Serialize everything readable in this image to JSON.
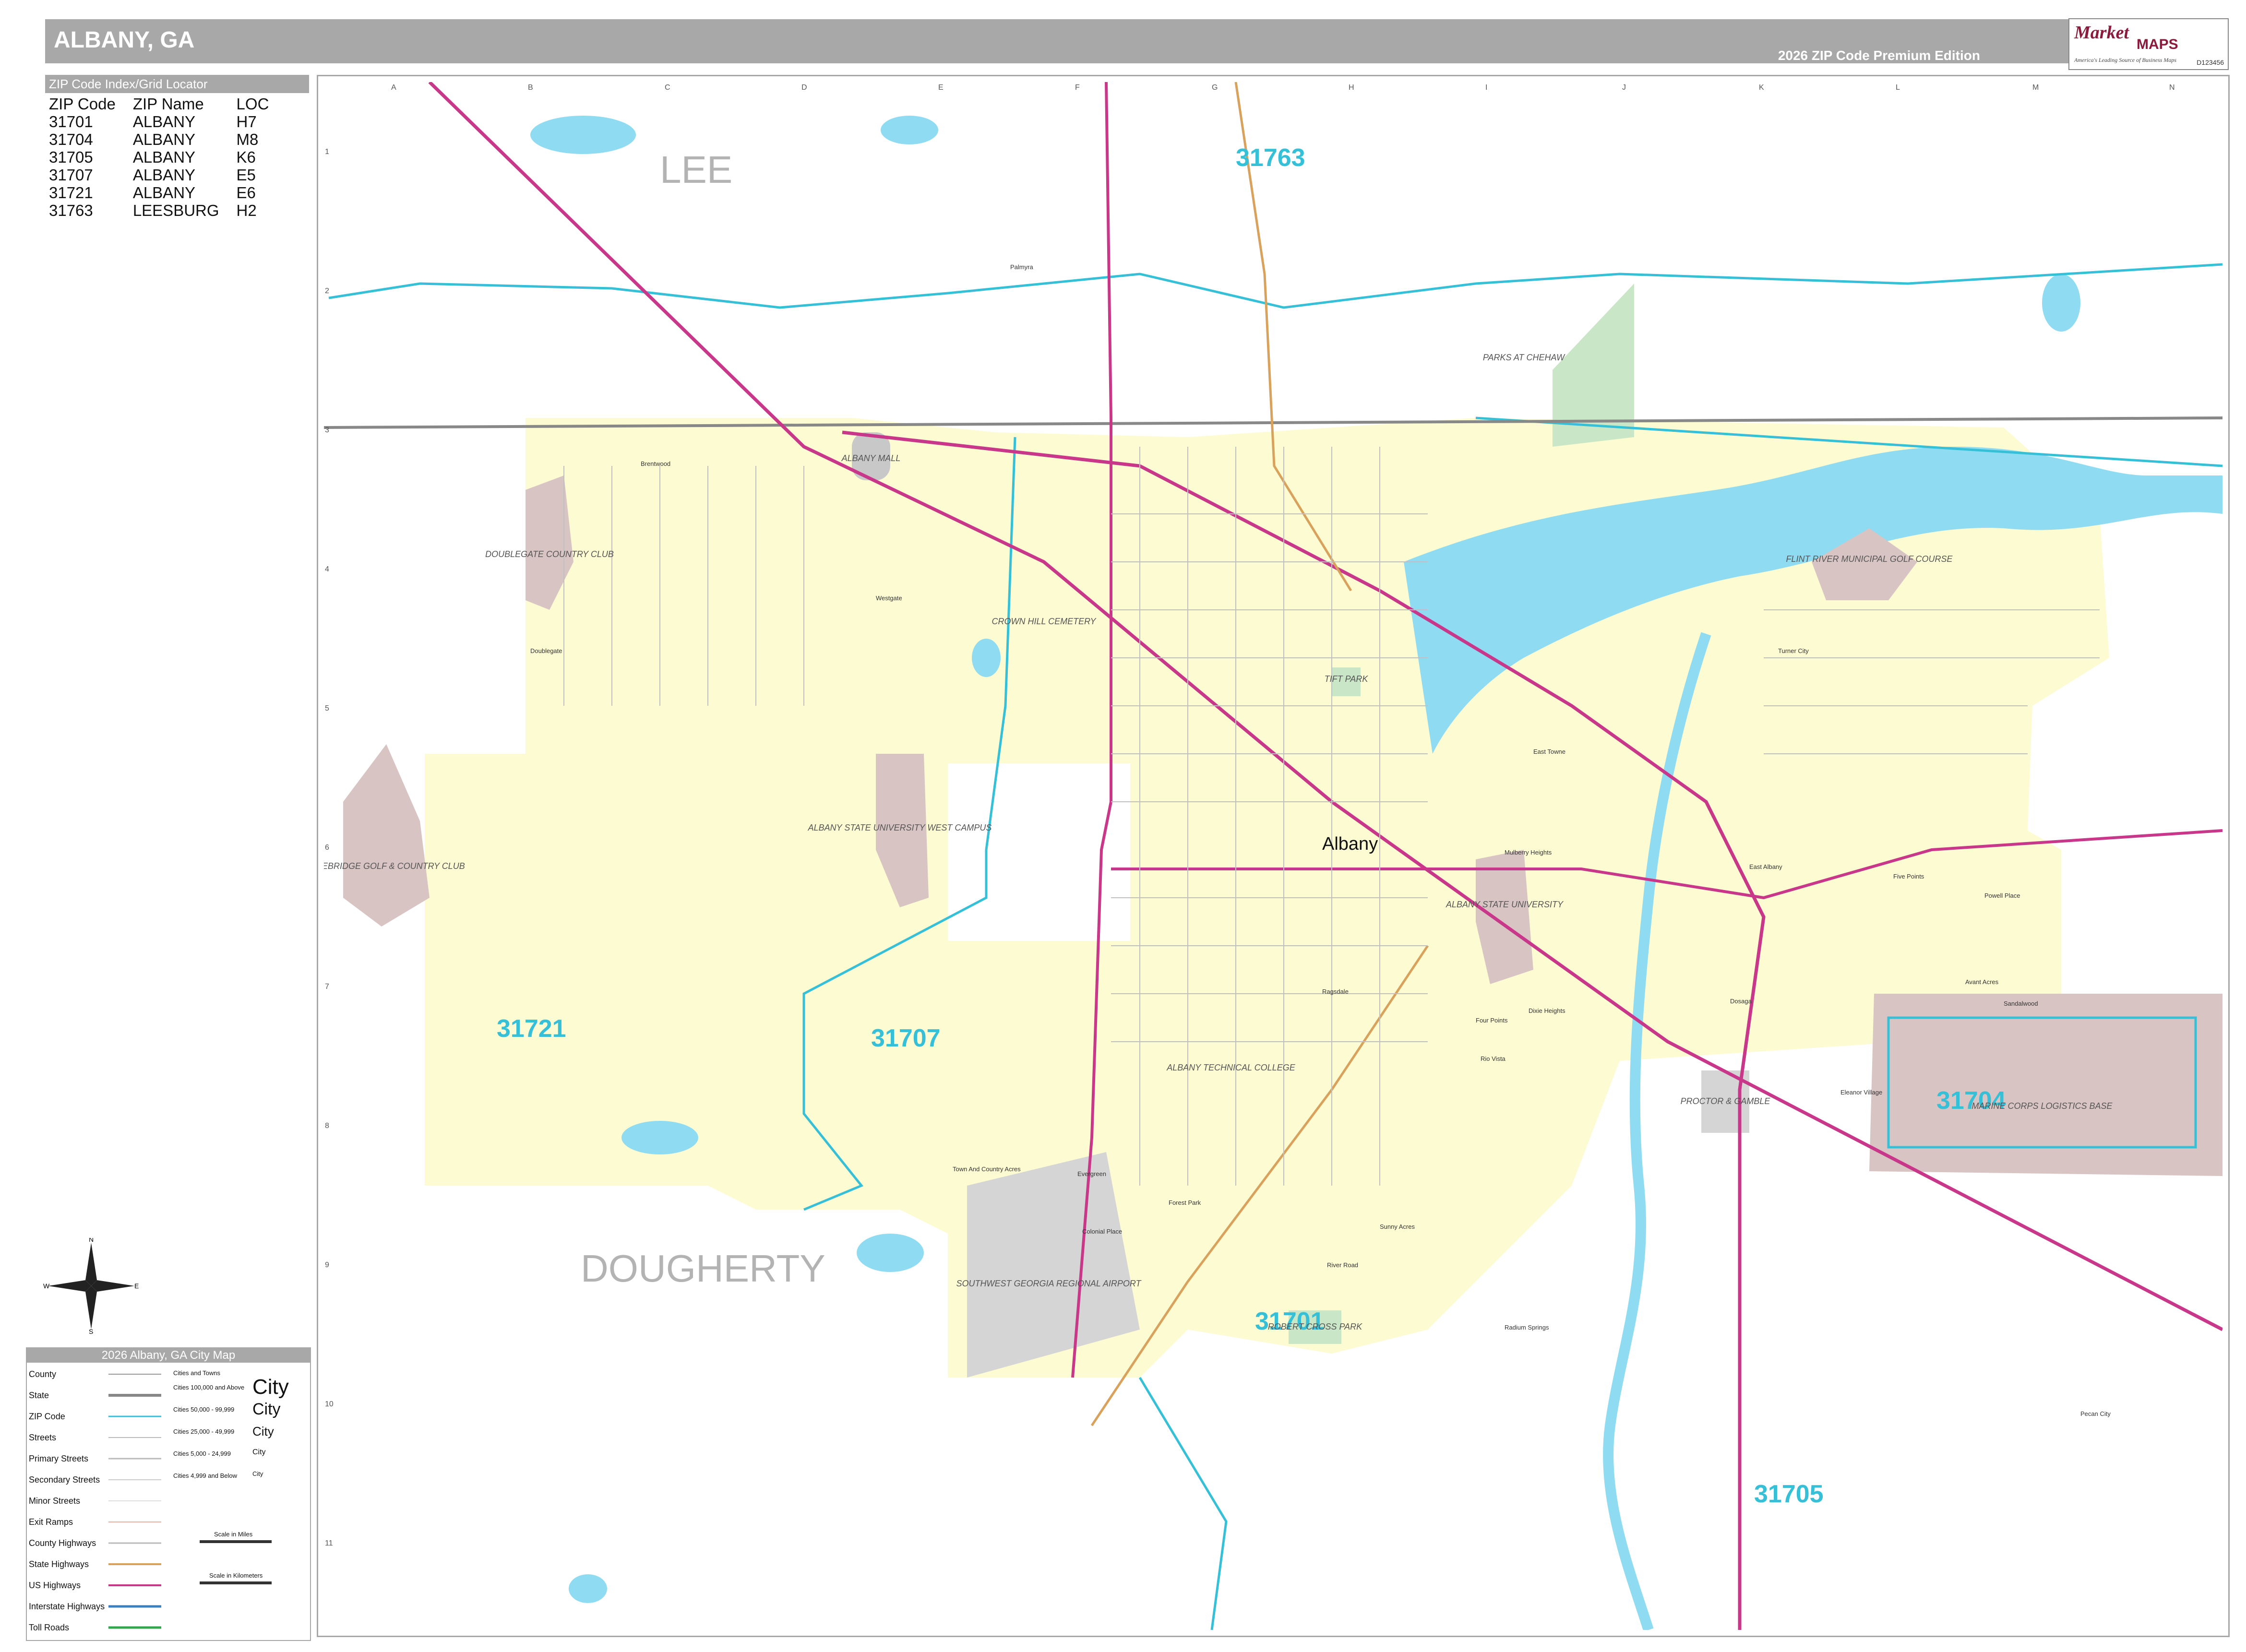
{
  "header": {
    "title": "ALBANY, GA",
    "edition": "2026 ZIP Code Premium Edition"
  },
  "logo": {
    "brand": "Market",
    "brand2": "MAPS",
    "tagline": "America's Leading Source of Business Maps",
    "code": "D123456"
  },
  "zip_index": {
    "heading": "ZIP Code Index/Grid Locator",
    "columns": [
      "ZIP Code",
      "ZIP Name",
      "LOC"
    ],
    "rows": [
      [
        "31701",
        "ALBANY",
        "H7"
      ],
      [
        "31704",
        "ALBANY",
        "M8"
      ],
      [
        "31705",
        "ALBANY",
        "K6"
      ],
      [
        "31707",
        "ALBANY",
        "E5"
      ],
      [
        "31721",
        "ALBANY",
        "E6"
      ],
      [
        "31763",
        "LEESBURG",
        "H2"
      ]
    ]
  },
  "grid": {
    "columns": [
      "A",
      "B",
      "C",
      "D",
      "E",
      "F",
      "G",
      "H",
      "I",
      "J",
      "K",
      "L",
      "M",
      "N"
    ],
    "rows": [
      "1",
      "2",
      "3",
      "4",
      "5",
      "6",
      "7",
      "8",
      "9",
      "10",
      "11"
    ]
  },
  "map_labels": {
    "county_lee": "LEE",
    "county_dougherty": "DOUGHERTY",
    "city_albany": "Albany",
    "zip_31763": "31763",
    "zip_31721": "31721",
    "zip_31707": "31707",
    "zip_31701": "31701",
    "zip_31704": "31704",
    "zip_31705": "31705",
    "parks_at_chehaw": "PARKS AT CHEHAW",
    "albany_mall": "ALBANY MALL",
    "doublegate_cc": "DOUBLEGATE COUNTRY CLUB",
    "stonebridge": "STONEBRIDGE GOLF & COUNTRY CLUB",
    "asu_west": "ALBANY STATE UNIVERSITY WEST CAMPUS",
    "asu": "ALBANY STATE UNIVERSITY",
    "flint_river_golf": "FLINT RIVER MUNICIPAL GOLF COURSE",
    "tift_park": "TIFT PARK",
    "marine_base": "MARINE CORPS LOGISTICS BASE",
    "airport": "SOUTHWEST GEORGIA REGIONAL AIRPORT",
    "robert_cross_park": "ROBERT CROSS PARK",
    "proctor_gamble": "PROCTOR & GAMBLE",
    "albany_tech": "ALBANY TECHNICAL COLLEGE",
    "crown_hill": "CROWN HILL CEMETERY",
    "palmyra": "Palmyra",
    "brentwood": "Brentwood",
    "westgate": "Westgate",
    "doublegate": "Doublegate",
    "turner_city": "Turner City",
    "east_towne": "East Towne",
    "mulberry_heights": "Mulberry Heights",
    "east_albany": "East Albany",
    "five_points": "Five Points",
    "powell_place": "Powell Place",
    "avant_acres": "Avant Acres",
    "sandalwood": "Sandalwood",
    "dosaga": "Dosaga",
    "ragsdale": "Ragsdale",
    "four_points": "Four Points",
    "dixie_heights": "Dixie Heights",
    "rio_vista": "Rio Vista",
    "eleanor_village": "Eleanor Village",
    "town_country": "Town And Country Acres",
    "evergreen": "Evergreen",
    "colonial_place": "Colonial Place",
    "forest_park": "Forest Park",
    "sunny_acres": "Sunny Acres",
    "river_road": "River Road",
    "radium_springs": "Radium Springs",
    "pecan_city": "Pecan City"
  },
  "legend": {
    "heading": "2026 Albany, GA City Map",
    "items": [
      "County",
      "State",
      "ZIP Code",
      "Streets",
      "Primary Streets",
      "Secondary Streets",
      "Minor Streets",
      "Exit Ramps",
      "County Highways",
      "State Highways",
      "US Highways",
      "Interstate Highways",
      "Toll Roads"
    ],
    "city_heading": "Cities and Towns",
    "city_tiers": [
      "Cities 100,000 and Above",
      "Cities 50,000 - 99,999",
      "Cities 25,000 - 49,999",
      "Cities 5,000 - 24,999",
      "Cities 4,999 and Below"
    ],
    "city_word": "City",
    "scale_miles": "Scale in Miles",
    "scale_km": "Scale in Kilometers"
  },
  "compass": {
    "n": "N",
    "s": "S",
    "e": "E",
    "w": "W"
  },
  "colors": {
    "header": "#a8a8a8",
    "city_fill": "#fdfbd2",
    "water": "#8fdcf2",
    "zip_line": "#36c0d8",
    "zip_label": "#36c0d8",
    "us_highway": "#c8378a",
    "state_highway": "#d9a25c",
    "interstate": "#3a7fc0",
    "park": "#c9e6c6",
    "special": "#d9c4c4",
    "airport": "#d5d5d5",
    "county_label": "#b3b3b3"
  }
}
